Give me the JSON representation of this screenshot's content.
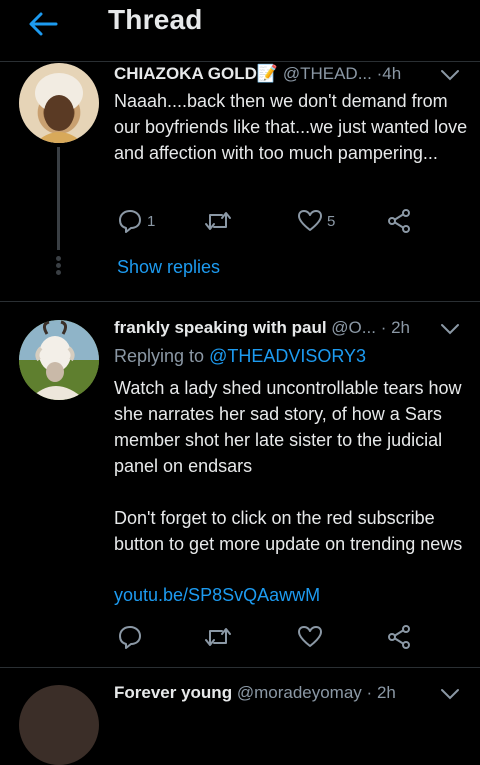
{
  "header": {
    "title": "Thread"
  },
  "tweets": [
    {
      "name": "CHIAZOKA GOLD",
      "emoji": "📝",
      "handle": "@THEAD...",
      "dot": "·",
      "time": "4h",
      "text": "Naaah....back then we don't demand from our boyfriends like that...we just wanted love and affection with too much pampering...",
      "replies": "1",
      "likes": "5"
    },
    {
      "name": "frankly speaking with paul",
      "handle": "@O...",
      "dot": "·",
      "time": "2h",
      "replying_prefix": "Replying to",
      "replying_to": "@THEADVISORY3",
      "text": "Watch a lady shed uncontrollable tears how she narrates her sad story, of how a Sars member shot her late sister to the judicial panel on endsars\n\nDon't forget to click on the red subscribe button to get more update on trending news",
      "link": "youtu.be/SP8SvQAawwM"
    },
    {
      "name": "Forever young",
      "handle": "@moradeyomay",
      "dot": "·",
      "time": "2h"
    }
  ],
  "show_replies": "Show replies",
  "colors": {
    "accent": "#1d9bf0",
    "background": "#000000",
    "muted": "#8b98a5"
  },
  "icons": [
    "back-arrow-icon",
    "reply-icon",
    "retweet-icon",
    "like-icon",
    "share-icon",
    "chevron-down-icon"
  ]
}
